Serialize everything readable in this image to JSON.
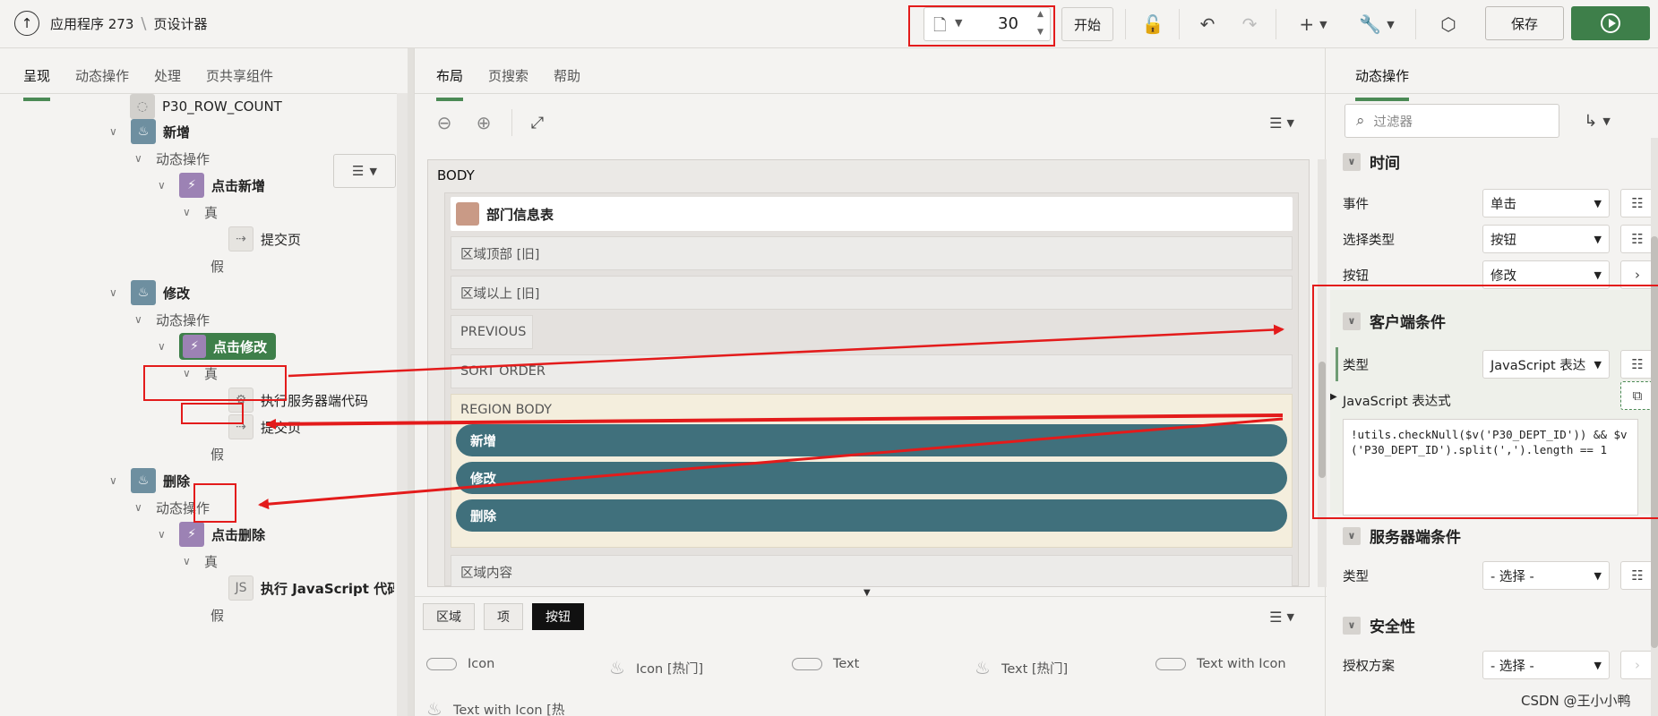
{
  "header": {
    "app_name": "应用程序 273",
    "page_designer": "页设计器",
    "page_number": "30",
    "go_label": "开始",
    "save_label": "保存",
    "add_icon_label": "+"
  },
  "left": {
    "tabs": [
      "呈现",
      "动态操作",
      "处理",
      "页共享组件"
    ],
    "tree": {
      "row_count": "P30_ROW_COUNT",
      "new_region": "新增",
      "da_group_1": "动态操作",
      "da_click_new": "点击新增",
      "true_1": "真",
      "submit_page_1": "提交页",
      "false_1": "假",
      "edit_region": "修改",
      "da_group_2": "动态操作",
      "da_click_edit": "点击修改",
      "true_2": "真",
      "exec_server_code": "执行服务器端代码",
      "submit_page_2": "提交页",
      "false_2": "假",
      "delete_region": "删除",
      "da_group_3": "动态操作",
      "da_click_delete": "点击删除",
      "true_3": "真",
      "exec_js": "执行 JavaScript 代码",
      "false_3": "假"
    }
  },
  "center": {
    "tabs": [
      "布局",
      "页搜索",
      "帮助"
    ],
    "body_label": "BODY",
    "region_title": "部门信息表",
    "slots": [
      "区域顶部 [旧]",
      "区域以上 [旧]",
      "PREVIOUS",
      "SORT ORDER",
      "REGION BODY"
    ],
    "buttons": [
      "新增",
      "修改",
      "删除"
    ],
    "content_slot": "区域内容",
    "gallery_tabs": [
      "区域",
      "项",
      "按钮"
    ],
    "gallery_items": [
      "Icon",
      "Icon [热门]",
      "Text",
      "Text [热门]",
      "Text with Icon",
      "Text with Icon [热"
    ]
  },
  "right": {
    "tab": "动态操作",
    "filter_placeholder": "过滤器",
    "sections": {
      "timing": "时间",
      "client_condition": "客户端条件",
      "server_condition": "服务器端条件",
      "security": "安全性"
    },
    "timing_rows": [
      {
        "label": "事件",
        "value": "单击"
      },
      {
        "label": "选择类型",
        "value": "按钮"
      },
      {
        "label": "按钮",
        "value": "修改"
      }
    ],
    "client": {
      "type_label": "类型",
      "type_value": "JavaScript 表达",
      "expr_label": "JavaScript 表达式",
      "expression": "!utils.checkNull($v('P30_DEPT_ID')) && $v('P30_DEPT_ID').split(',').length == 1"
    },
    "server": {
      "type_label": "类型",
      "type_value": "- 选择 -"
    },
    "security": {
      "auth_label": "授权方案",
      "auth_value": "- 选择 -"
    }
  },
  "watermark": "CSDN @王小小鸭"
}
